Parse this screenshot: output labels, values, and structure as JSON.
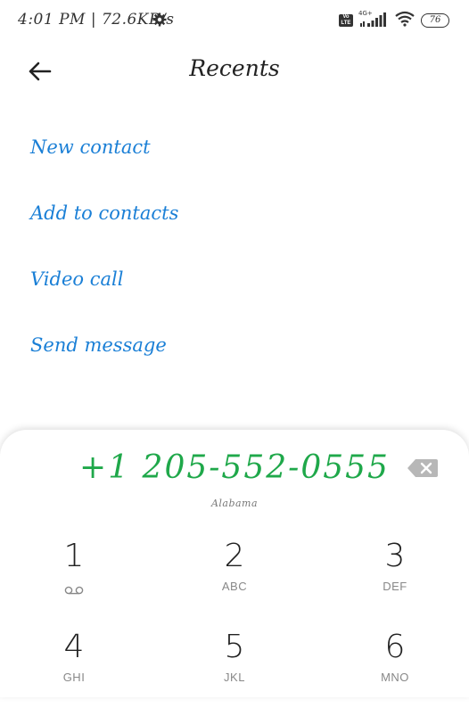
{
  "status_bar": {
    "time_speed": "4:01 PM | 72.6KB/s",
    "volte_label": "Vo LTE",
    "network_label": "4G+",
    "battery": "76",
    "icons": [
      "gear-icon",
      "volte-icon",
      "signal-icon",
      "wifi-icon",
      "battery-icon"
    ]
  },
  "header": {
    "title": "Recents",
    "back_icon": "arrow-left-icon"
  },
  "actions": [
    {
      "label": "New contact"
    },
    {
      "label": "Add to contacts"
    },
    {
      "label": "Video call"
    },
    {
      "label": "Send message"
    }
  ],
  "dialer": {
    "number": "+1 205-552-0555",
    "location": "Alabama",
    "backspace_icon": "backspace-icon",
    "keys": [
      {
        "digit": "1",
        "letters": "",
        "icon": "voicemail-icon"
      },
      {
        "digit": "2",
        "letters": "ABC"
      },
      {
        "digit": "3",
        "letters": "DEF"
      },
      {
        "digit": "4",
        "letters": "GHI"
      },
      {
        "digit": "5",
        "letters": "JKL"
      },
      {
        "digit": "6",
        "letters": "MNO"
      }
    ]
  },
  "colors": {
    "accent_blue": "#1a7fd6",
    "number_green": "#1fa84a"
  }
}
